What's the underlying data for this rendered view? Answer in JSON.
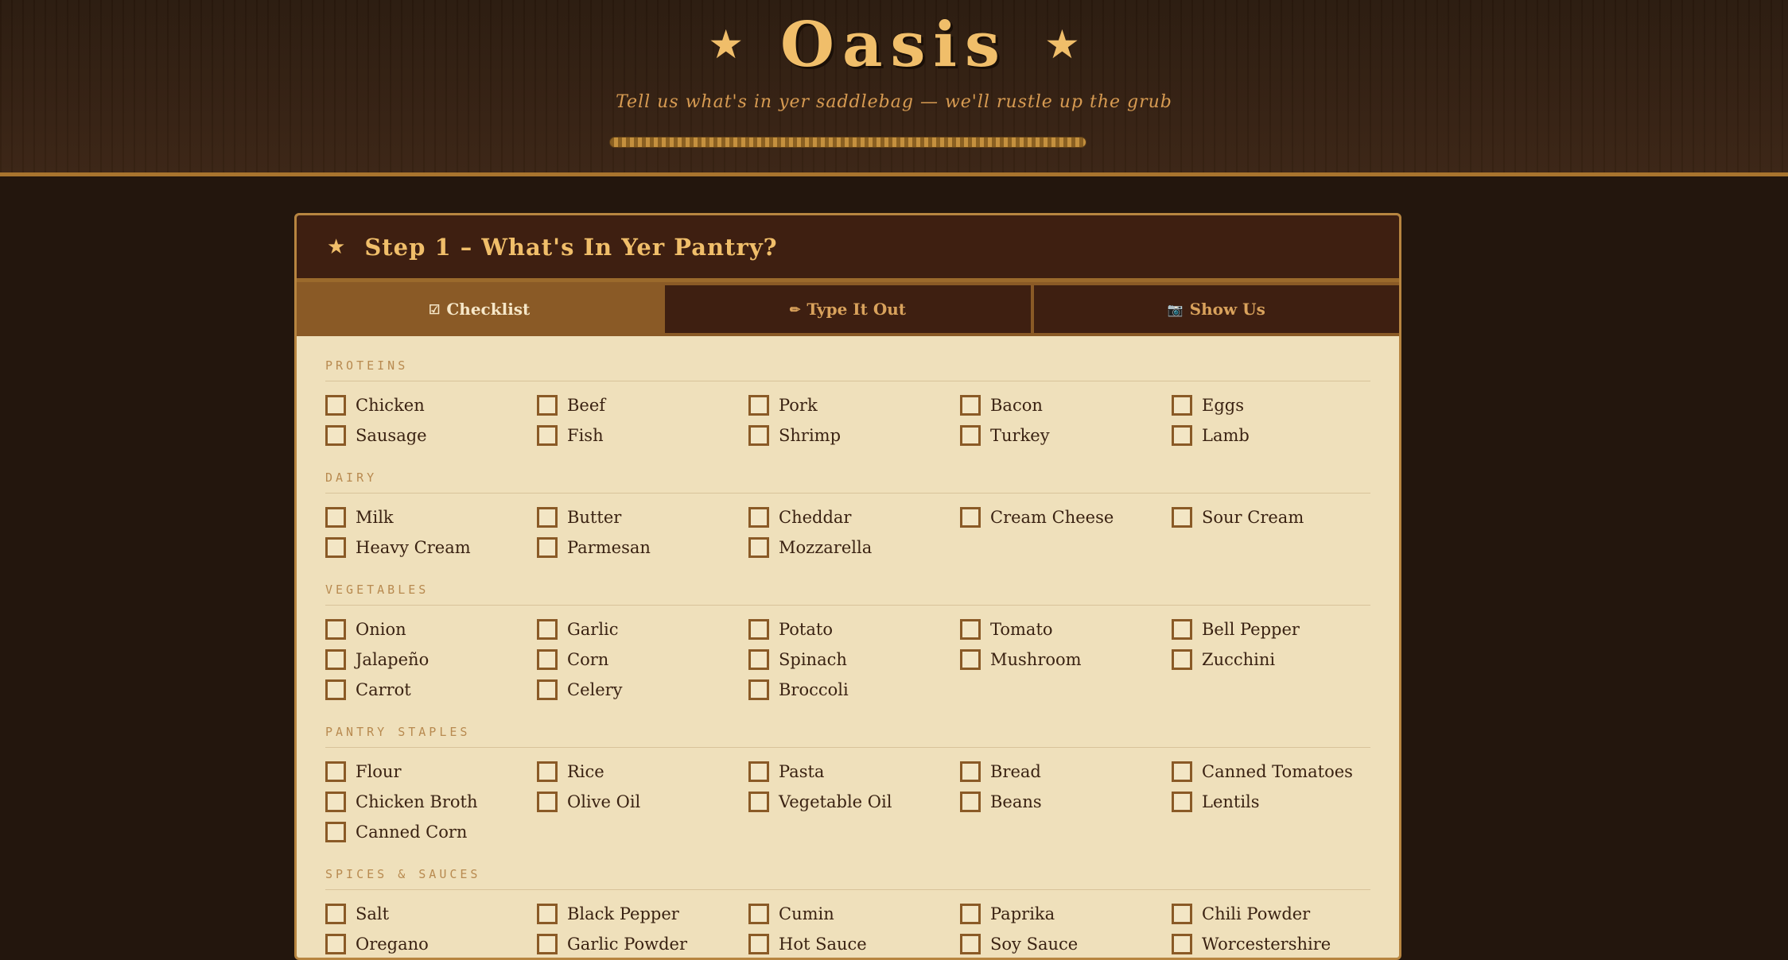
{
  "header": {
    "title": "Oasis",
    "tagline": "Tell us what's in yer saddlebag — we'll rustle up the grub",
    "star_icon": "star-icon"
  },
  "panel": {
    "title": "Step 1 – What's In Yer Pantry?",
    "tabs": [
      {
        "icon": "☑",
        "label": "Checklist",
        "active": true
      },
      {
        "icon": "✏",
        "label": "Type It Out",
        "active": false
      },
      {
        "icon": "📷",
        "label": "Show Us",
        "active": false
      }
    ]
  },
  "sections": [
    {
      "label": "PROTEINS",
      "items": [
        "Chicken",
        "Beef",
        "Pork",
        "Bacon",
        "Eggs",
        "Sausage",
        "Fish",
        "Shrimp",
        "Turkey",
        "Lamb"
      ]
    },
    {
      "label": "DAIRY",
      "items": [
        "Milk",
        "Butter",
        "Cheddar",
        "Cream Cheese",
        "Sour Cream",
        "Heavy Cream",
        "Parmesan",
        "Mozzarella"
      ]
    },
    {
      "label": "VEGETABLES",
      "items": [
        "Onion",
        "Garlic",
        "Potato",
        "Tomato",
        "Bell Pepper",
        "Jalapeño",
        "Corn",
        "Spinach",
        "Mushroom",
        "Zucchini",
        "Carrot",
        "Celery",
        "Broccoli"
      ]
    },
    {
      "label": "PANTRY STAPLES",
      "items": [
        "Flour",
        "Rice",
        "Pasta",
        "Bread",
        "Canned Tomatoes",
        "Chicken Broth",
        "Olive Oil",
        "Vegetable Oil",
        "Beans",
        "Lentils",
        "Canned Corn"
      ]
    },
    {
      "label": "SPICES & SAUCES",
      "items": [
        "Salt",
        "Black Pepper",
        "Cumin",
        "Paprika",
        "Chili Powder",
        "Oregano",
        "Garlic Powder",
        "Hot Sauce",
        "Soy Sauce",
        "Worcestershire"
      ]
    }
  ],
  "colors": {
    "accent": "#f0be6a",
    "brown": "#3e1f11",
    "parchment": "#efe0bb"
  }
}
